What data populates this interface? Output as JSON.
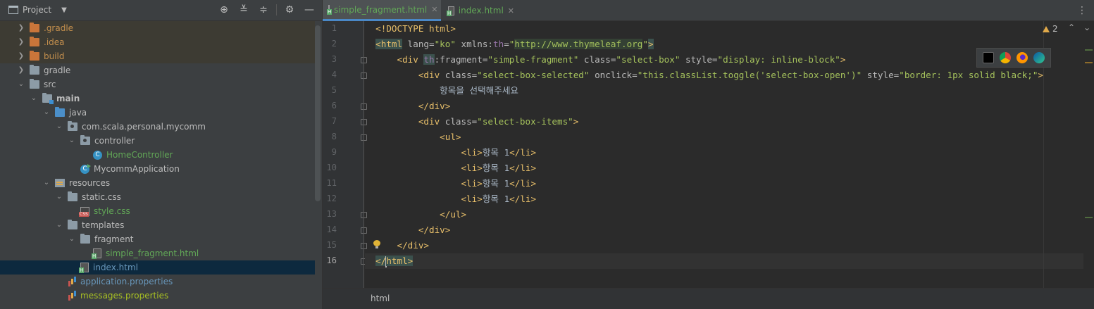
{
  "project_panel": {
    "title": "Project",
    "tree": [
      {
        "label": ".gradle",
        "style": "excluded"
      },
      {
        "label": ".idea",
        "style": "excluded"
      },
      {
        "label": "build",
        "style": "excluded"
      },
      {
        "label": "gradle"
      },
      {
        "label": "src"
      },
      {
        "label": "main"
      },
      {
        "label": "java"
      },
      {
        "label": "com.scala.personal.mycomm"
      },
      {
        "label": "controller"
      },
      {
        "label": "HomeController"
      },
      {
        "label": "MycommApplication"
      },
      {
        "label": "resources"
      },
      {
        "label": "static.css"
      },
      {
        "label": "style.css"
      },
      {
        "label": "templates"
      },
      {
        "label": "fragment"
      },
      {
        "label": "simple_fragment.html"
      },
      {
        "label": "index.html",
        "selected": true
      },
      {
        "label": "application.properties"
      },
      {
        "label": "messages.properties"
      }
    ]
  },
  "editor": {
    "tabs": [
      {
        "label": "simple_fragment.html",
        "active": true
      },
      {
        "label": "index.html",
        "active": false
      }
    ],
    "line_numbers": [
      "1",
      "2",
      "3",
      "4",
      "5",
      "6",
      "7",
      "8",
      "9",
      "10",
      "11",
      "12",
      "13",
      "14",
      "15",
      "16"
    ],
    "code": {
      "l1": "<!DOCTYPE html>",
      "l2_open": "<html",
      "l2_lang_attr": " lang=",
      "l2_lang_val": "\"ko\"",
      "l2_xmlns_attr": " xmlns:",
      "l2_th": "th",
      "l2_eq": "=",
      "l2_q1": "\"",
      "l2_url": "http://www.thymeleaf.org",
      "l2_q2": "\"",
      "l2_close": ">",
      "l3_open": "<div",
      "l3_th": "th",
      "l3_frag_attr": ":fragment=",
      "l3_frag_val": "\"simple-fragment\"",
      "l3_class_attr": " class=",
      "l3_class_val": "\"select-box\"",
      "l3_style_attr": " style=",
      "l3_style_val": "\"display: inline-block\"",
      "l3_close": ">",
      "l4_open": "<div",
      "l4_class_attr": " class=",
      "l4_class_val": "\"select-box-selected\"",
      "l4_onclick_attr": " onclick=",
      "l4_onclick_val": "\"this.classList.toggle('select-box-open')\"",
      "l4_style_attr": " style=",
      "l4_style_val": "\"border: 1px solid black;\"",
      "l4_close": ">",
      "l5": "항목을 선택해주세요",
      "l6": "</div>",
      "l7_open": "<div",
      "l7_class_attr": " class=",
      "l7_class_val": "\"select-box-items\"",
      "l7_close": ">",
      "l8": "<ul>",
      "li_open": "<li>",
      "li_text": "항목 1",
      "li_close": "</li>",
      "l13": "</ul>",
      "l14": "</div>",
      "l15": "</div>",
      "l16_a": "</",
      "l16_b": "html>"
    },
    "inspection_count": "2",
    "nav_up": "⌃",
    "nav_down": "⌄",
    "breadcrumb": "html"
  }
}
